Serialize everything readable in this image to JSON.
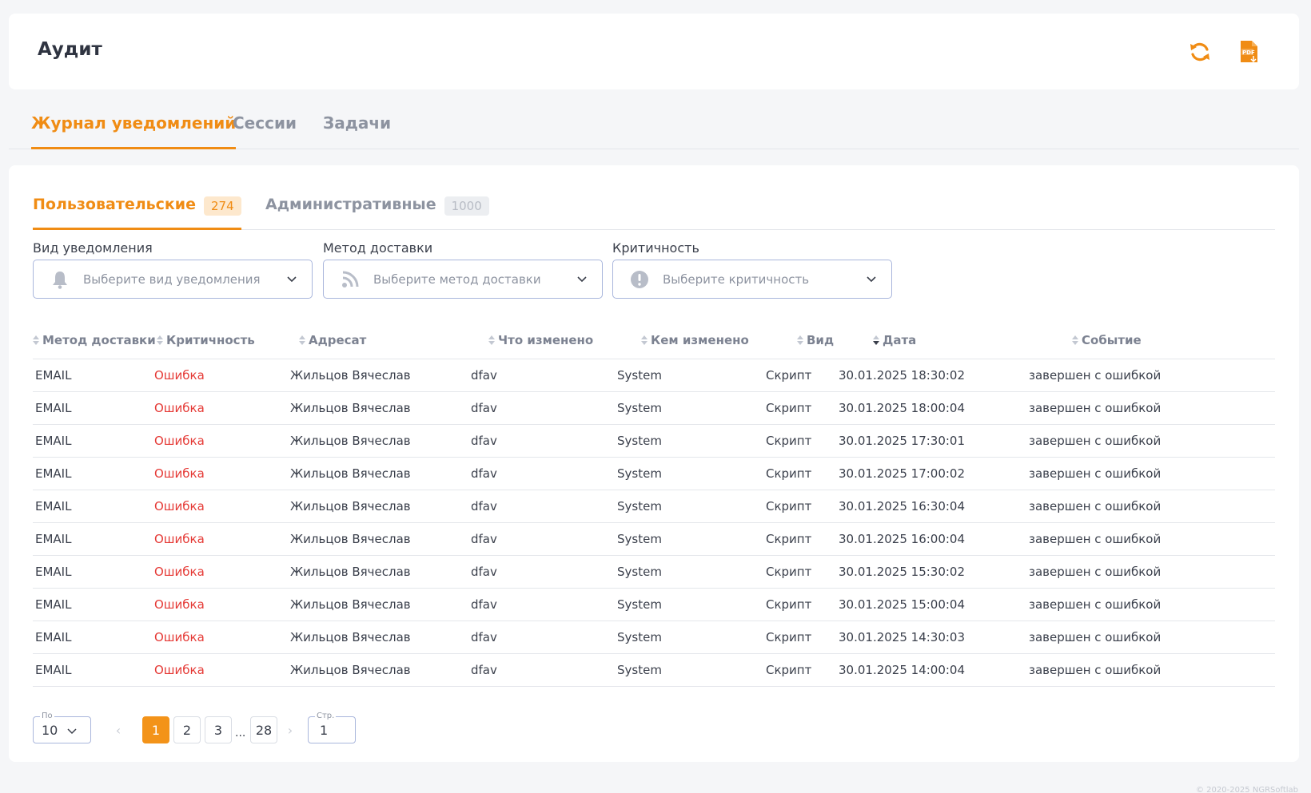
{
  "header": {
    "title": "Аудит",
    "refresh_icon": "refresh-icon",
    "pdf_icon": "pdf-export-icon",
    "accent": "#f08c14"
  },
  "main_tabs": [
    {
      "label": "Журнал уведомлений",
      "active": true
    },
    {
      "label": "Сессии",
      "active": false
    },
    {
      "label": "Задачи",
      "active": false
    }
  ],
  "sub_tabs": [
    {
      "label": "Пользовательские",
      "count": "274",
      "active": true
    },
    {
      "label": "Административные",
      "count": "1000",
      "active": false
    }
  ],
  "filters": [
    {
      "label": "Вид уведомления",
      "placeholder": "Выберите вид уведомления",
      "icon": "bell-icon"
    },
    {
      "label": "Метод доставки",
      "placeholder": "Выберите метод доставки",
      "icon": "rss-icon"
    },
    {
      "label": "Критичность",
      "placeholder": "Выберите критичность",
      "icon": "alert-icon"
    }
  ],
  "table": {
    "columns": [
      "Метод доставки",
      "Критичность",
      "Адресат",
      "Что изменено",
      "Кем изменено",
      "Вид",
      "Дата",
      "Событие"
    ],
    "sorted_column": "Дата",
    "sort_direction": "desc",
    "rows": [
      [
        "EMAIL",
        "Ошибка",
        "Жильцов Вячеслав",
        "dfav",
        "System",
        "Скрипт",
        "30.01.2025 18:30:02",
        "завершен с ошибкой"
      ],
      [
        "EMAIL",
        "Ошибка",
        "Жильцов Вячеслав",
        "dfav",
        "System",
        "Скрипт",
        "30.01.2025 18:00:04",
        "завершен с ошибкой"
      ],
      [
        "EMAIL",
        "Ошибка",
        "Жильцов Вячеслав",
        "dfav",
        "System",
        "Скрипт",
        "30.01.2025 17:30:01",
        "завершен с ошибкой"
      ],
      [
        "EMAIL",
        "Ошибка",
        "Жильцов Вячеслав",
        "dfav",
        "System",
        "Скрипт",
        "30.01.2025 17:00:02",
        "завершен с ошибкой"
      ],
      [
        "EMAIL",
        "Ошибка",
        "Жильцов Вячеслав",
        "dfav",
        "System",
        "Скрипт",
        "30.01.2025 16:30:04",
        "завершен с ошибкой"
      ],
      [
        "EMAIL",
        "Ошибка",
        "Жильцов Вячеслав",
        "dfav",
        "System",
        "Скрипт",
        "30.01.2025 16:00:04",
        "завершен с ошибкой"
      ],
      [
        "EMAIL",
        "Ошибка",
        "Жильцов Вячеслав",
        "dfav",
        "System",
        "Скрипт",
        "30.01.2025 15:30:02",
        "завершен с ошибкой"
      ],
      [
        "EMAIL",
        "Ошибка",
        "Жильцов Вячеслав",
        "dfav",
        "System",
        "Скрипт",
        "30.01.2025 15:00:04",
        "завершен с ошибкой"
      ],
      [
        "EMAIL",
        "Ошибка",
        "Жильцов Вячеслав",
        "dfav",
        "System",
        "Скрипт",
        "30.01.2025 14:30:03",
        "завершен с ошибкой"
      ],
      [
        "EMAIL",
        "Ошибка",
        "Жильцов Вячеслав",
        "dfav",
        "System",
        "Скрипт",
        "30.01.2025 14:00:04",
        "завершен с ошибкой"
      ]
    ],
    "error_color": "#e53935"
  },
  "pagination": {
    "per_page_label": "По",
    "per_page_value": "10",
    "pages": [
      "1",
      "2",
      "3"
    ],
    "ellipsis": "...",
    "last_page": "28",
    "current_page": "1",
    "prev_label": "‹",
    "next_label": "›",
    "goto_label": "Стр.",
    "goto_value": "1"
  },
  "footer": {
    "copyright": "© 2020-2025 NGRSoftlab"
  }
}
